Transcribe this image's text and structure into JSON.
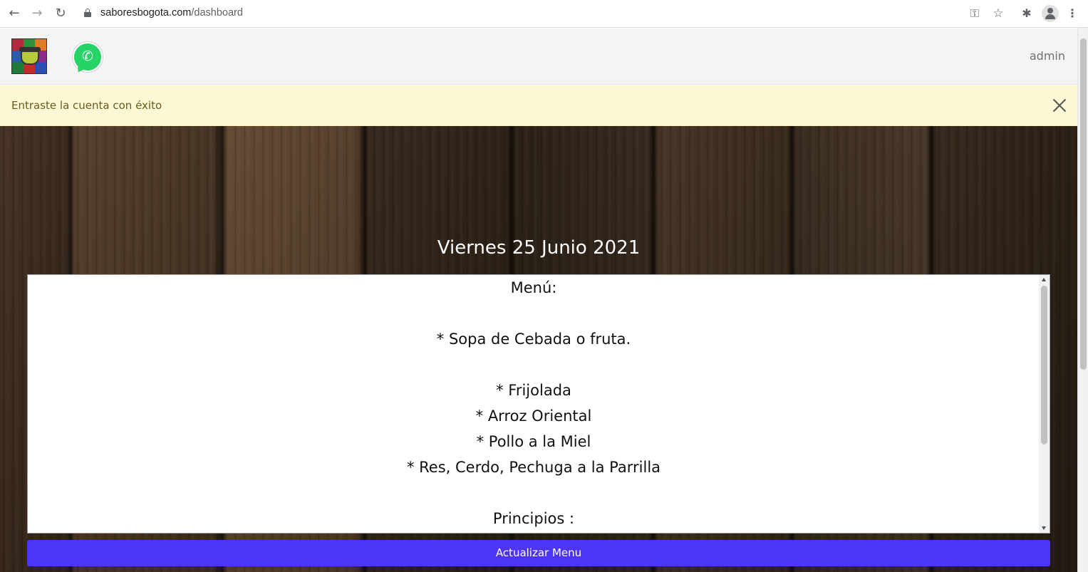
{
  "browser": {
    "url_host": "saboresbogota.com",
    "url_path": "/dashboard",
    "back_icon": "←",
    "forward_icon": "→",
    "reload_icon": "↻",
    "key_icon": "⚿",
    "star_icon": "☆",
    "extensions_icon": "✱",
    "menu_icon": "⋮"
  },
  "header": {
    "logo_icon": "restaurant-pot-logo",
    "whatsapp_icon": "whatsapp-icon",
    "admin_label": "admin"
  },
  "alert": {
    "message": "Entraste la cuenta con éxito",
    "status_color": "#fcf8d6"
  },
  "menu": {
    "date": "Viernes 25 Junio 2021",
    "lines": [
      "Menú:",
      "",
      "* Sopa de Cebada o fruta.",
      "",
      "* Frijolada",
      "* Arroz Oriental",
      "* Pollo a la Miel",
      "* Res, Cerdo, Pechuga a la Parrilla",
      "",
      "Principios :"
    ],
    "update_button": "Actualizar Menu",
    "accent_color": "#4c35f5"
  }
}
